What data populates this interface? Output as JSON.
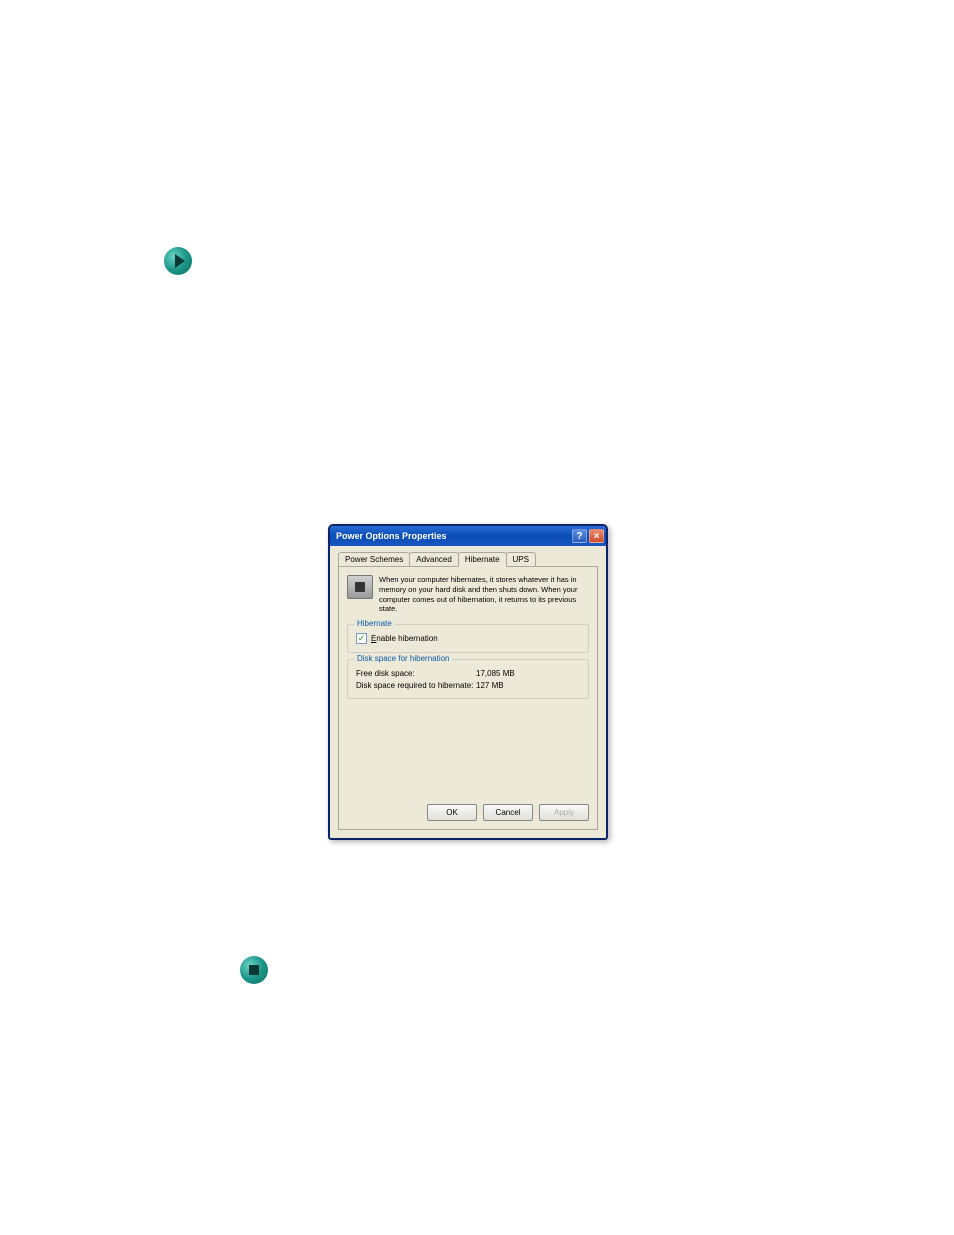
{
  "decorations": {
    "play_icon": "play-icon",
    "stop_icon": "stop-icon"
  },
  "dialog": {
    "title": "Power Options Properties",
    "help_btn": "?",
    "close_btn": "×",
    "tabs": [
      "Power Schemes",
      "Advanced",
      "Hibernate",
      "UPS"
    ],
    "active_tab": "Hibernate",
    "info_text": "When your computer hibernates, it stores whatever it has in memory on your hard disk and then shuts down. When your computer comes out of hibernation, it returns to its previous state.",
    "hibernate_group": {
      "title": "Hibernate",
      "checkbox_checked": true,
      "checkbox_label": "Enable hibernation"
    },
    "disk_group": {
      "title": "Disk space for hibernation",
      "free_label": "Free disk space:",
      "free_value": "17,085 MB",
      "required_label": "Disk space required to hibernate:",
      "required_value": "127 MB"
    },
    "buttons": {
      "ok": "OK",
      "cancel": "Cancel",
      "apply": "Apply"
    }
  }
}
